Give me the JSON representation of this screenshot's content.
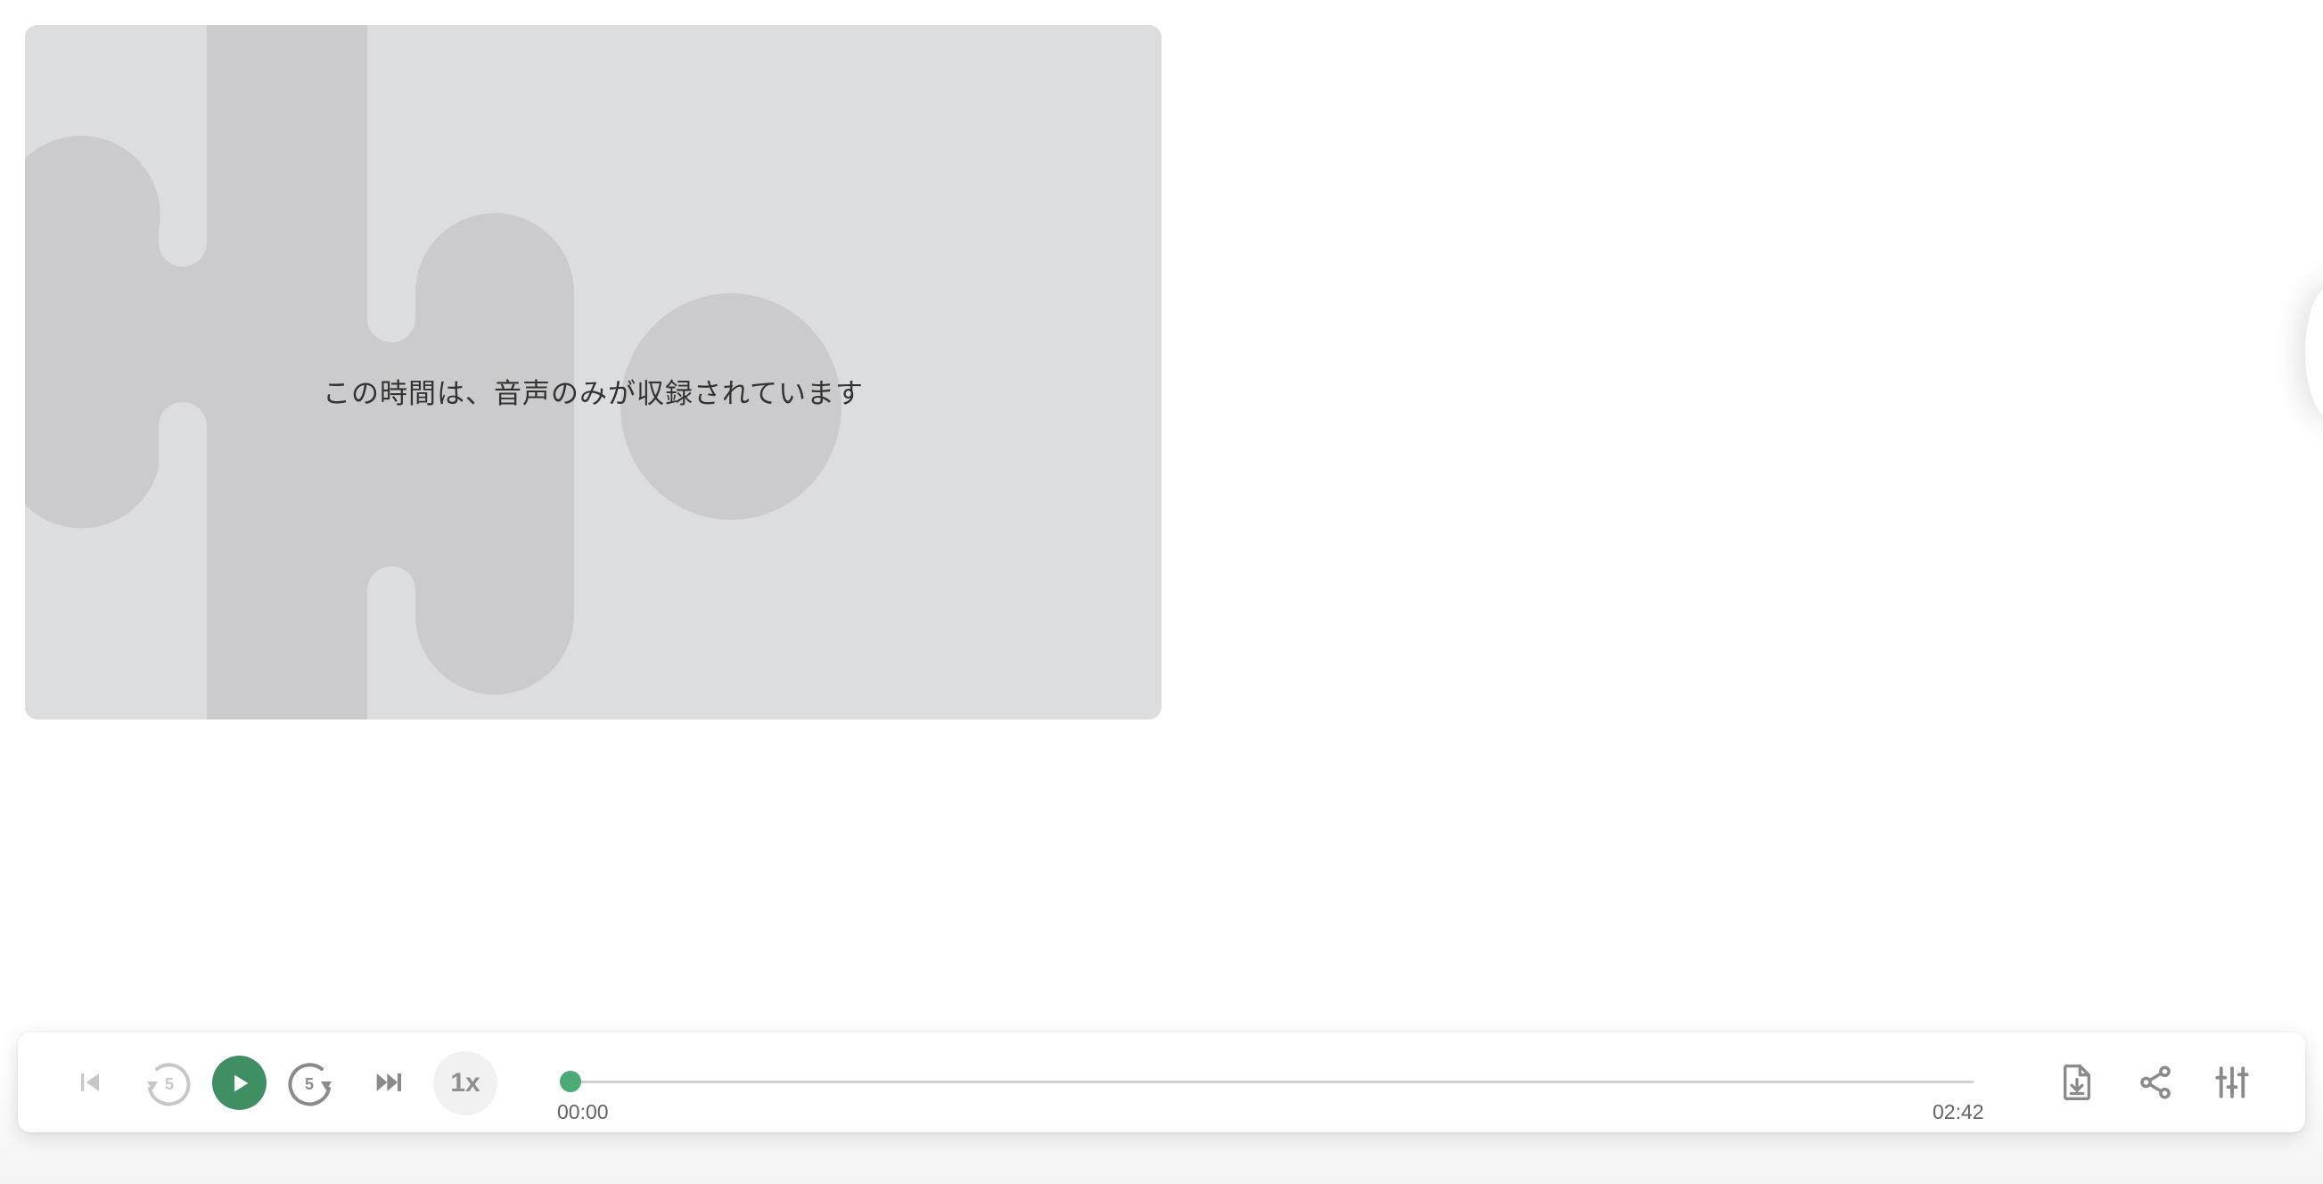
{
  "video": {
    "message": "この時間は、音声のみが収録されています"
  },
  "player": {
    "speed_label": "1x",
    "time_current": "00:00",
    "time_total": "02:42",
    "progress_fraction": 0,
    "skip_seconds": "5",
    "icons": {
      "skip_previous": "skip-previous-icon",
      "rewind": "rewind-5-icon",
      "play": "play-icon",
      "forward": "forward-5-icon",
      "skip_next": "skip-next-icon",
      "download": "download-file-icon",
      "share": "share-icon",
      "settings": "tune-icon"
    }
  },
  "colors": {
    "accent": "#3f8f63",
    "thumb": "#4caa75",
    "panel_bg": "#dcdddf",
    "panel_shapes": "#cbcbcd",
    "icon_gray": "#8a8a8a",
    "icon_disabled": "#c8c8c8"
  }
}
